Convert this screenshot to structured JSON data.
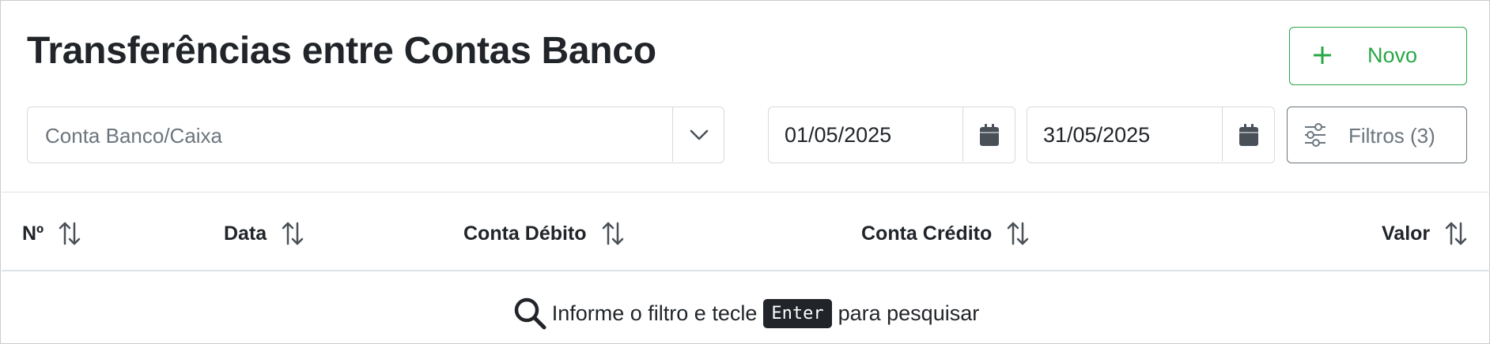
{
  "page": {
    "title": "Transferências entre Contas Banco"
  },
  "toolbar": {
    "new_button": {
      "label": "Novo",
      "icon": "plus-icon",
      "color": "#28a745"
    }
  },
  "filters": {
    "account_select": {
      "placeholder": "Conta Banco/Caixa",
      "icon": "chevron-down-icon"
    },
    "date_from": {
      "value": "01/05/2025",
      "icon": "calendar-icon"
    },
    "date_to": {
      "value": "31/05/2025",
      "icon": "calendar-icon"
    },
    "filters_button": {
      "label": "Filtros (3)",
      "icon": "sliders-icon"
    }
  },
  "table": {
    "columns": [
      {
        "label": "Nº",
        "icon": "sort-icon"
      },
      {
        "label": "Data",
        "icon": "sort-icon"
      },
      {
        "label": "Conta Débito",
        "icon": "sort-icon"
      },
      {
        "label": "Conta Crédito",
        "icon": "sort-icon"
      },
      {
        "label": "Valor",
        "icon": "sort-icon"
      }
    ],
    "empty_state": {
      "text_before": "Informe o filtro e tecle",
      "key": "Enter",
      "text_after": "para pesquisar",
      "icon": "search-icon"
    }
  }
}
